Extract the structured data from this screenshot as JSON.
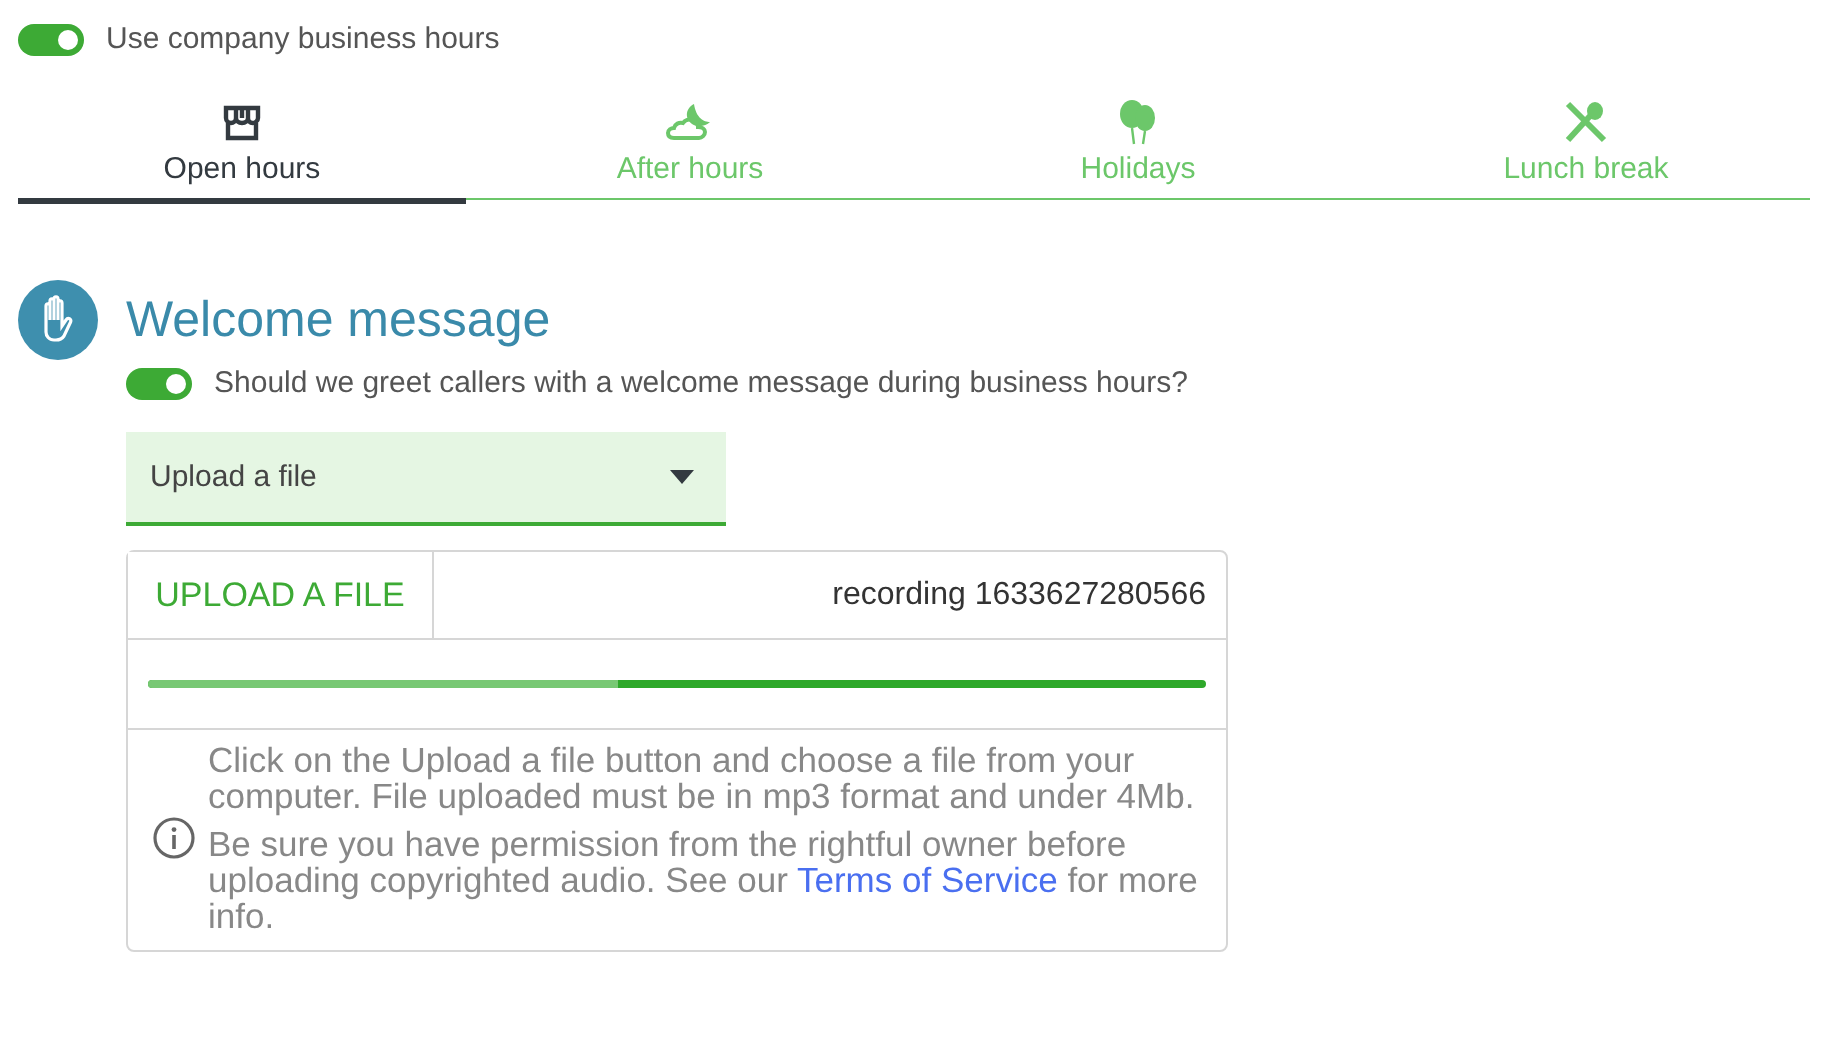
{
  "business_hours_toggle": {
    "label": "Use company business hours",
    "on": true
  },
  "tabs": [
    {
      "label": "Open hours",
      "kind": "store",
      "selected": true
    },
    {
      "label": "After hours",
      "kind": "moon",
      "selected": false
    },
    {
      "label": "Holidays",
      "kind": "balloons",
      "selected": false
    },
    {
      "label": "Lunch break",
      "kind": "utensils",
      "selected": false
    }
  ],
  "section": {
    "title": "Welcome message",
    "greeting_toggle": {
      "label": "Should we greet callers with a welcome message during business hours?",
      "on": true
    },
    "source_dropdown": {
      "value": "Upload a file"
    },
    "upload": {
      "button": "UPLOAD A FILE",
      "file_name": "recording 1633627280566",
      "progress": {
        "level": 0.445
      },
      "info": {
        "paragraph_1": "Click on the Upload a file button and choose a file from your computer. File uploaded must be in mp3 format and under 4Mb.",
        "paragraph_2_before": "Be sure you have permission from the rightful owner before uploading copyrighted audio. See our",
        "link": "Terms of Service",
        "paragraph_2_after": "for more info."
      }
    }
  }
}
